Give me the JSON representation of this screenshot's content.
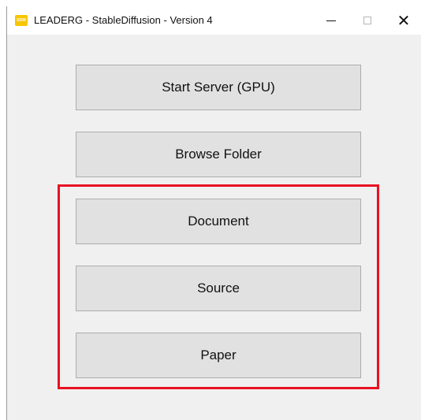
{
  "window": {
    "title": "LEADERG - StableDiffusion - Version 4",
    "icon_name": "app-logo-icon",
    "icon_text": "SDW",
    "controls": {
      "minimize": "minimize-icon",
      "maximize": "maximize-icon",
      "close": "close-icon",
      "close_glyph": "✕"
    }
  },
  "buttons": [
    {
      "label": "Start Server (GPU)"
    },
    {
      "label": "Browse Folder"
    },
    {
      "label": "Document"
    },
    {
      "label": "Source"
    },
    {
      "label": "Paper"
    }
  ],
  "highlight": {
    "color": "#e81123",
    "covers": [
      "Document",
      "Source",
      "Paper"
    ]
  },
  "colors": {
    "window_bg": "#f0f0f0",
    "button_bg": "#e1e1e1",
    "button_border": "#adadad",
    "app_icon": "#f7c600"
  }
}
